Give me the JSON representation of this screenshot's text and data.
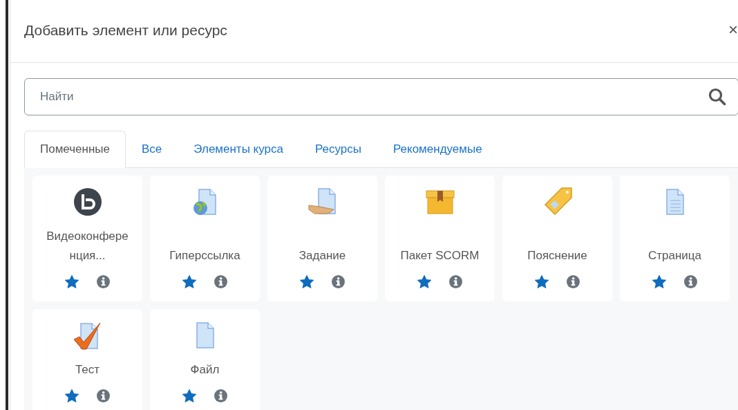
{
  "dialog": {
    "title": "Добавить элемент или ресурс",
    "close": "×"
  },
  "search": {
    "placeholder": "Найти"
  },
  "tabs": [
    {
      "label": "Помеченные",
      "selected": true
    },
    {
      "label": "Все",
      "selected": false
    },
    {
      "label": "Элементы курса",
      "selected": false
    },
    {
      "label": "Ресурсы",
      "selected": false
    },
    {
      "label": "Рекомендуемые",
      "selected": false
    }
  ],
  "items": [
    {
      "kind": "bbb",
      "label": "Видеоконфере нция...",
      "starred": true
    },
    {
      "kind": "url",
      "label": "Гиперссылка",
      "starred": true
    },
    {
      "kind": "assign",
      "label": "Задание",
      "starred": true
    },
    {
      "kind": "scorm",
      "label": "Пакет SCORM",
      "starred": true
    },
    {
      "kind": "label",
      "label": "Пояснение",
      "starred": true
    },
    {
      "kind": "page",
      "label": "Страница",
      "starred": true
    },
    {
      "kind": "quiz",
      "label": "Тест",
      "starred": true
    },
    {
      "kind": "file",
      "label": "Файл",
      "starred": true
    }
  ]
}
